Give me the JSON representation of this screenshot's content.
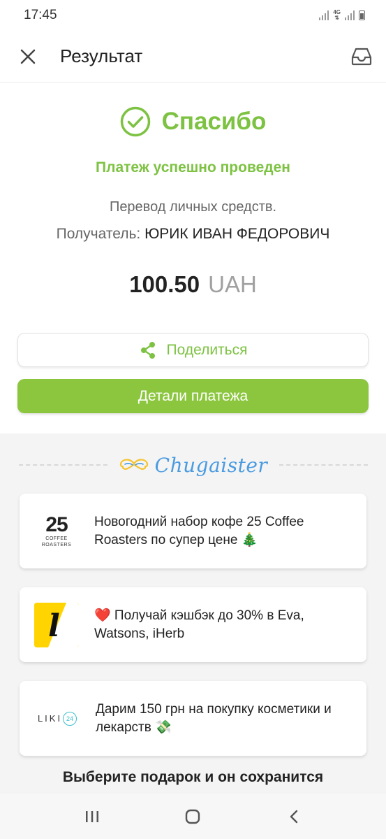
{
  "status_bar": {
    "time": "17:45",
    "network": "4G"
  },
  "app_bar": {
    "title": "Результат",
    "close_icon": "close-icon",
    "inbox_icon": "inbox-icon"
  },
  "result": {
    "thanks": "Спасибо",
    "success": "Платеж успешно проведен",
    "transfer": "Перевод личных средств.",
    "recipient_label": "Получатель:",
    "recipient_name": " ЮРИК ИВАН ФЕДОРОВИЧ",
    "amount": "100.50",
    "currency": "UAH"
  },
  "actions": {
    "share_label": "Поделиться",
    "details_label": "Детали платежа"
  },
  "promo": {
    "brand": "Chugaister",
    "offers": [
      {
        "logo_text": "25",
        "logo_sub": "COFFEE ROASTERS",
        "text": "Новогодний набор кофе 25 Coffee Roasters по супер цене 🎄"
      },
      {
        "logo_text": "l",
        "text": "❤️ Получай кэшбэк до 30% в Eva, Watsons, iHerb"
      },
      {
        "logo_text": "LIKI",
        "logo_badge": "24",
        "text": "Дарим 150 грн на покупку косметики и лекарств 💸"
      }
    ],
    "gift_heading": "Выберите подарок и он сохранится"
  },
  "colors": {
    "accent": "#7dc242",
    "button": "#8cc63f",
    "brand": "#4a9be0",
    "brand_mustache": "#f4c430",
    "liki_badge": "#3bbfcf"
  }
}
